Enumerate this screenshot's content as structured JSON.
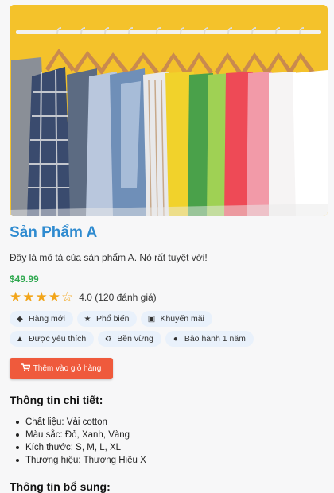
{
  "product": {
    "name": "Sản Phẩm A",
    "description": "Đây là mô tả của sản phẩm A. Nó rất tuyệt vời!",
    "price": "$49.99",
    "rating": {
      "value": 4,
      "max": 5,
      "text": "4.0 (120 đánh giá)"
    },
    "image_icon": "clothes-rack-photo"
  },
  "tags": [
    {
      "label": "Hàng mới",
      "icon": "tag-icon"
    },
    {
      "label": "Phổ biến",
      "icon": "star-icon"
    },
    {
      "label": "Khuyến mãi",
      "icon": "gift-icon"
    },
    {
      "label": "Được yêu thích",
      "icon": "thumbs-up-icon"
    },
    {
      "label": "Bền vững",
      "icon": "recycle-icon"
    },
    {
      "label": "Bảo hành 1 năm",
      "icon": "user-shield-icon"
    }
  ],
  "cart_button": {
    "label": "Thêm vào giỏ hàng",
    "icon": "cart-icon"
  },
  "details_section": {
    "title": "Thông tin chi tiết:",
    "items": [
      "Chất liệu: Vải cotton",
      "Màu sắc: Đỏ, Xanh, Vàng",
      "Kích thước: S, M, L, XL",
      "Thương hiệu: Thương Hiệu X"
    ]
  },
  "extra_section": {
    "title": "Thông tin bổ sung:"
  },
  "colors": {
    "title": "#2f8bd0",
    "price": "#2fa84f",
    "star": "#f2a51a",
    "chip_bg": "#e9f1fb",
    "button": "#ef5a3c"
  }
}
